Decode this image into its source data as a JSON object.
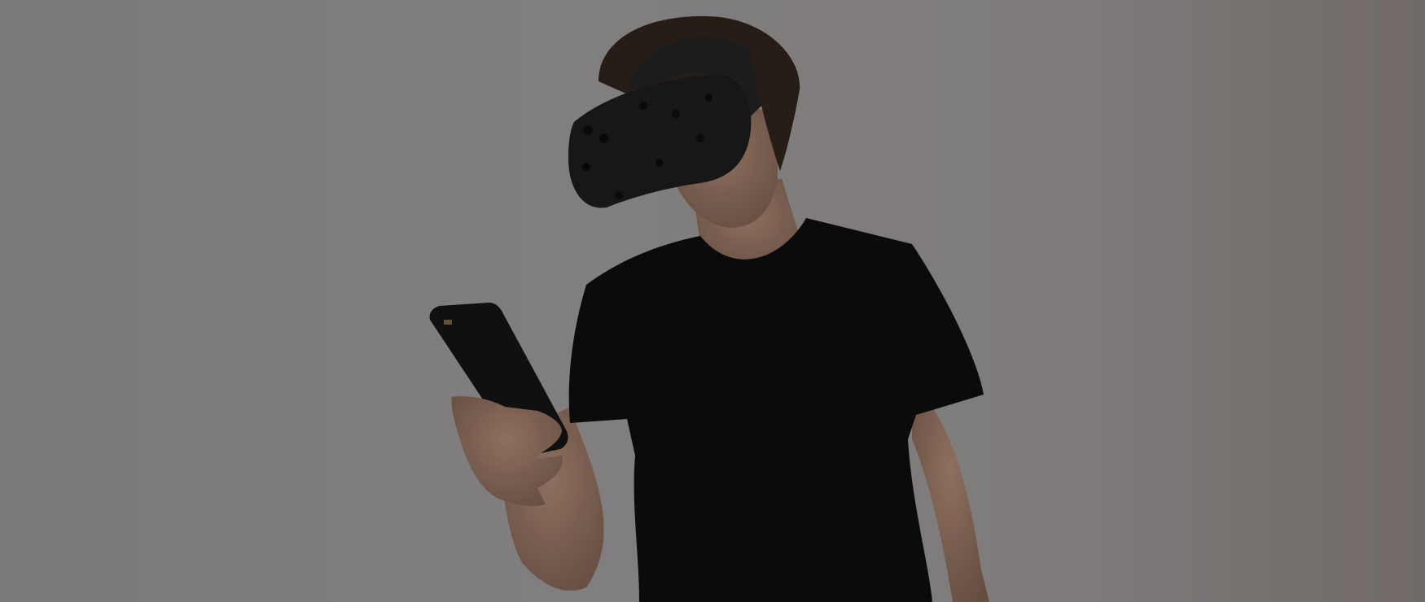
{
  "hero": {
    "colors": {
      "background": "#8a8888",
      "shirt": "#0d0c0c",
      "headset": "#1a1a1b",
      "skin": "#8f6f5e",
      "hair": "#2a2018",
      "phone": "#121212"
    }
  }
}
